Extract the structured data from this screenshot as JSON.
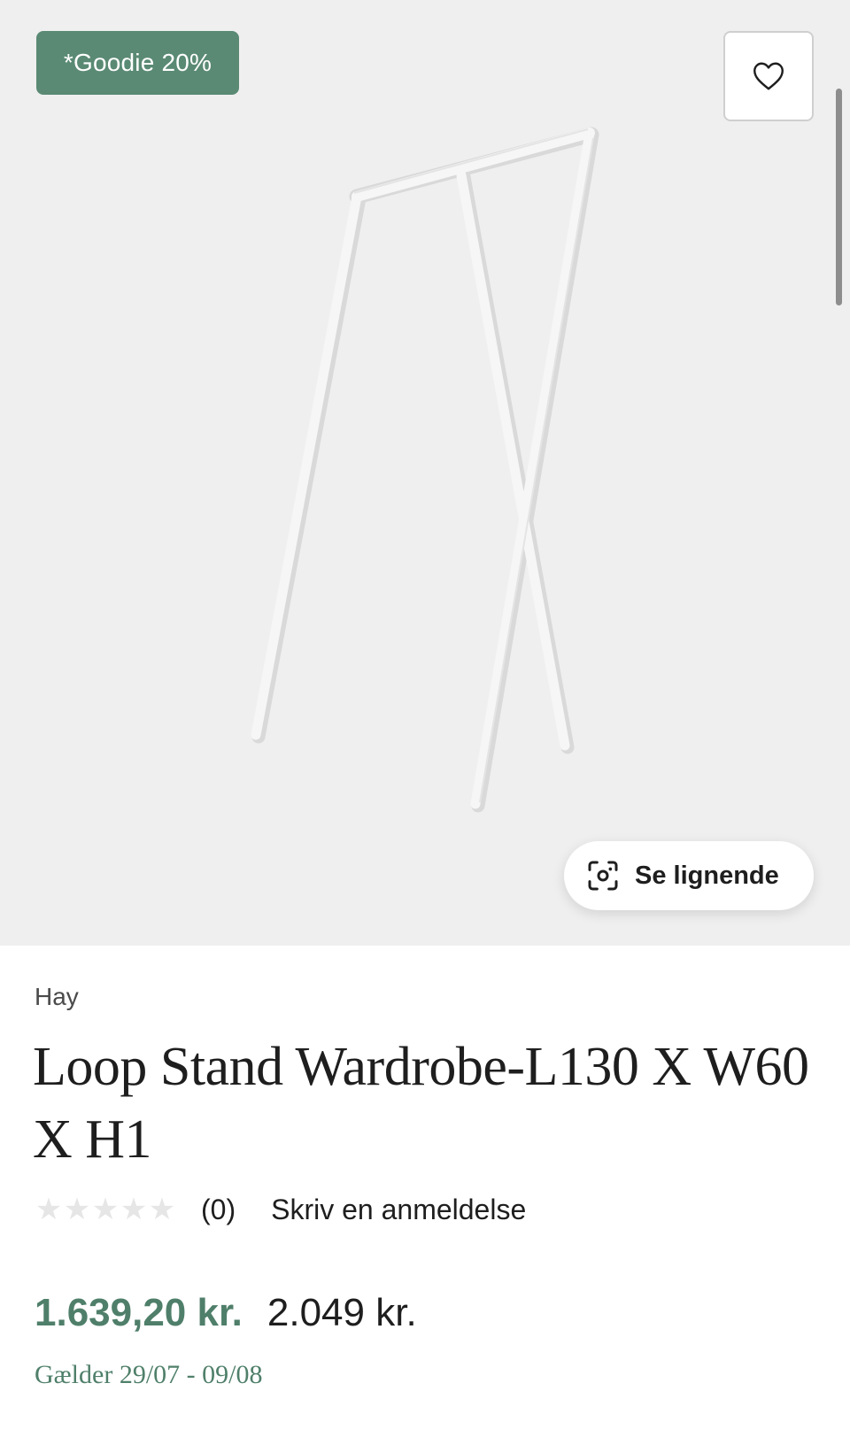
{
  "product": {
    "badge": "*Goodie 20%",
    "similar_label": "Se lignende",
    "brand": "Hay",
    "title": "Loop Stand Wardrobe-L130 X W60 X H1",
    "rating": {
      "stars_filled": 0,
      "stars_total": 5,
      "count_text": "(0)",
      "write_review": "Skriv en anmeldelse"
    },
    "price": {
      "sale": "1.639,20 kr.",
      "original": "2.049 kr."
    },
    "validity": "Gælder 29/07 - 09/08"
  },
  "icons": {
    "favorite": "heart-icon",
    "similar": "visual-search-icon",
    "star": "star-icon"
  },
  "colors": {
    "accent_green": "#5a8a74",
    "price_green": "#4f7f6a",
    "image_background": "#efefef",
    "star_empty": "#e6e6e6"
  }
}
